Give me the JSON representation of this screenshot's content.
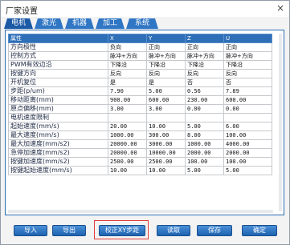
{
  "window": {
    "title": "厂家设置",
    "close_label": "×"
  },
  "tabs": [
    {
      "label": "电机",
      "active": true
    },
    {
      "label": "激光",
      "active": false
    },
    {
      "label": "机器",
      "active": false
    },
    {
      "label": "加工",
      "active": false
    },
    {
      "label": "系统",
      "active": false
    }
  ],
  "grid": {
    "headers": [
      "属性",
      "X",
      "Y",
      "Z",
      "U"
    ],
    "rows": [
      [
        "方向极性",
        "负向",
        "正向",
        "正向",
        "正向"
      ],
      [
        "控制方式",
        "脉冲+方向",
        "脉冲+方向",
        "脉冲+方向",
        "脉冲+方向"
      ],
      [
        "PWM有效边沿",
        "下降沿",
        "下降沿",
        "下降沿",
        "下降沿"
      ],
      [
        "按键方向",
        "反向",
        "反向",
        "反向",
        "反向"
      ],
      [
        "开机复位",
        "是",
        "是",
        "否",
        "否"
      ],
      [
        "步距(p/um)",
        "7.90",
        "5.00",
        "0.56",
        "7.89"
      ],
      [
        "移动距离(mm)",
        "900.00",
        "600.00",
        "230.00",
        "600.00"
      ],
      [
        "原点偏移(mm)",
        "3.00",
        "3.00",
        "0.00",
        "0.00"
      ],
      [
        "电机速度限制",
        "",
        "",
        "",
        ""
      ],
      [
        "起始速度(mm/s)",
        "20.00",
        "10.00",
        "5.00",
        "6.00"
      ],
      [
        "最大速度(mm/s)",
        "1000.00",
        "300.00",
        "8.00",
        "100.00"
      ],
      [
        "最大加速度(mm/s2)",
        "20000.00",
        "3000.00",
        "1000.00",
        "4000.00"
      ],
      [
        "急停加速度(mm/s2)",
        "20000.00",
        "10000.00",
        "2000.00",
        "2000.00"
      ],
      [
        "按键加速度(mm/s2)",
        "2500.00",
        "2500.00",
        "100.00",
        "100.00"
      ],
      [
        "按键起始速度(mm/s)",
        "10.00",
        "10.00",
        "5.00",
        "5.00"
      ]
    ]
  },
  "buttons": {
    "import": "导入",
    "export": "导出",
    "calibrate": "校正XY步距",
    "read": "读取",
    "save": "保存",
    "ok": "确定"
  },
  "colors": {
    "accent": "#2e6fb7",
    "highlight": "#e23b3b"
  }
}
